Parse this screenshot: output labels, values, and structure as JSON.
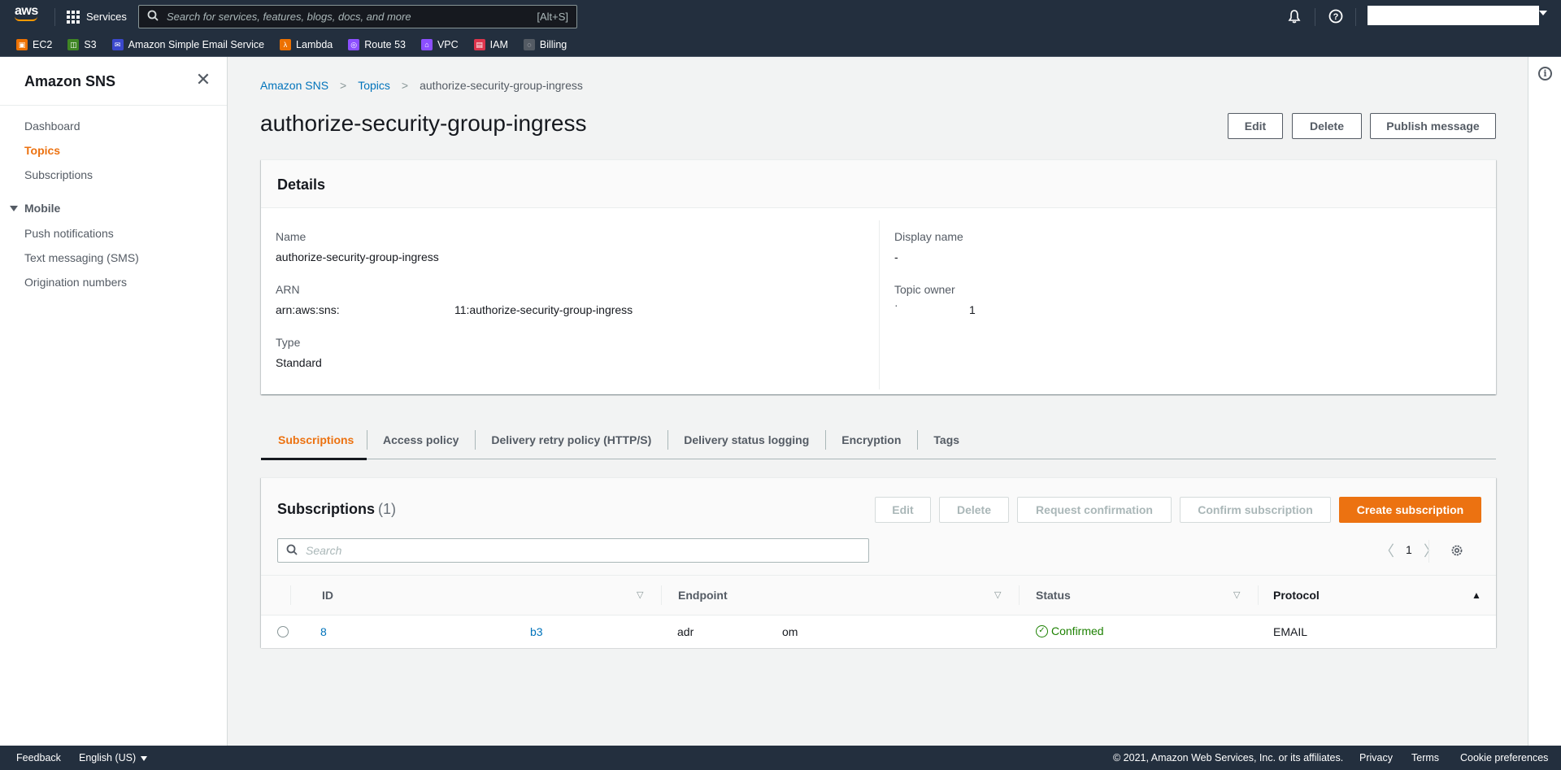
{
  "topnav": {
    "logo": "aws",
    "services_label": "Services",
    "search_placeholder": "Search for services, features, blogs, docs, and more",
    "search_shortcut": "[Alt+S]",
    "icons": [
      "bell-icon",
      "help-icon"
    ],
    "account_name": ""
  },
  "favorites": [
    {
      "label": "EC2",
      "icon": "ec2-icon",
      "color": "#ed7100"
    },
    {
      "label": "S3",
      "icon": "s3-icon",
      "color": "#3f8624"
    },
    {
      "label": "Amazon Simple Email Service",
      "icon": "ses-icon",
      "color": "#3b48cc"
    },
    {
      "label": "Lambda",
      "icon": "lambda-icon",
      "color": "#ed7100"
    },
    {
      "label": "Route 53",
      "icon": "route53-icon",
      "color": "#8c4fff"
    },
    {
      "label": "VPC",
      "icon": "vpc-icon",
      "color": "#8c4fff"
    },
    {
      "label": "IAM",
      "icon": "iam-icon",
      "color": "#dd344c"
    },
    {
      "label": "Billing",
      "icon": "billing-icon",
      "color": "#545b64"
    }
  ],
  "sidebar": {
    "title": "Amazon SNS",
    "items": [
      {
        "label": "Dashboard",
        "active": false
      },
      {
        "label": "Topics",
        "active": true
      },
      {
        "label": "Subscriptions",
        "active": false
      }
    ],
    "section": {
      "label": "Mobile",
      "expanded": true,
      "items": [
        {
          "label": "Push notifications"
        },
        {
          "label": "Text messaging (SMS)"
        },
        {
          "label": "Origination numbers"
        }
      ]
    }
  },
  "breadcrumb": [
    "Amazon SNS",
    "Topics",
    "authorize-security-group-ingress"
  ],
  "page": {
    "title": "authorize-security-group-ingress",
    "actions": {
      "edit": "Edit",
      "delete": "Delete",
      "publish": "Publish message"
    }
  },
  "details": {
    "heading": "Details",
    "name_label": "Name",
    "name_value": "authorize-security-group-ingress",
    "arn_label": "ARN",
    "arn_prefix": "arn:aws:sns:",
    "arn_suffix": "11:authorize-security-group-ingress",
    "type_label": "Type",
    "type_value": "Standard",
    "display_name_label": "Display name",
    "display_name_value": "-",
    "owner_label": "Topic owner",
    "owner_value_start": "·",
    "owner_value_end": "1"
  },
  "tabs": [
    {
      "label": "Subscriptions",
      "active": true
    },
    {
      "label": "Access policy",
      "active": false
    },
    {
      "label": "Delivery retry policy (HTTP/S)",
      "active": false
    },
    {
      "label": "Delivery status logging",
      "active": false
    },
    {
      "label": "Encryption",
      "active": false
    },
    {
      "label": "Tags",
      "active": false
    }
  ],
  "subscriptions": {
    "title": "Subscriptions",
    "count": "(1)",
    "buttons": {
      "edit": "Edit",
      "delete": "Delete",
      "request_confirmation": "Request confirmation",
      "confirm_subscription": "Confirm subscription",
      "create": "Create subscription"
    },
    "search_placeholder": "Search",
    "page": "1",
    "columns": [
      "ID",
      "Endpoint",
      "Status",
      "Protocol"
    ],
    "sorted_column": "Protocol",
    "sort_direction": "ascending",
    "rows": [
      {
        "id_start": "8",
        "id_end": "b3",
        "endpoint_start": "adr",
        "endpoint_end": "om",
        "status": "Confirmed",
        "protocol": "EMAIL"
      }
    ]
  },
  "footer": {
    "feedback": "Feedback",
    "language": "English (US)",
    "copyright": "© 2021, Amazon Web Services, Inc. or its affiliates.",
    "links": [
      "Privacy",
      "Terms",
      "Cookie preferences"
    ]
  },
  "colors": {
    "nav_bg": "#232f3e",
    "accent_orange": "#ec7211",
    "link_blue": "#0073bb",
    "success_green": "#1d8102"
  }
}
